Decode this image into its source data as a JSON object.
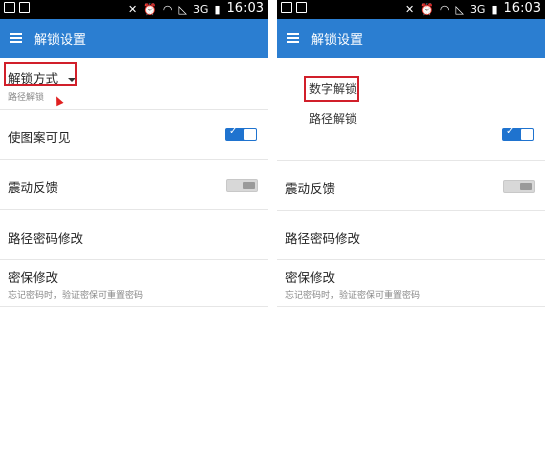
{
  "left": {
    "status": {
      "time": "16:03",
      "network": "3G"
    },
    "appbar": {
      "title": "解锁设置"
    },
    "unlock_method": {
      "label": "解锁方式",
      "value": "路径解锁"
    },
    "rows": [
      {
        "title": "使图案可见",
        "toggle": "on"
      },
      {
        "title": "震动反馈",
        "toggle": "off"
      },
      {
        "title": "路径密码修改"
      },
      {
        "title": "密保修改",
        "subtitle": "忘记密码时，验证密保可重置密码"
      }
    ]
  },
  "right": {
    "status": {
      "time": "16:03",
      "network": "3G"
    },
    "appbar": {
      "title": "解锁设置"
    },
    "menu": {
      "options": [
        "数字解锁",
        "路径解锁"
      ],
      "highlighted": "数字解锁"
    },
    "rows": [
      {
        "title": "震动反馈",
        "toggle": "off"
      },
      {
        "title": "路径密码修改"
      },
      {
        "title": "密保修改",
        "subtitle": "忘记密码时，验证密保可重置密码"
      }
    ],
    "pattern_visible_toggle": "on"
  },
  "colors": {
    "appbar": "#2b7ed1",
    "toggle_on": "#1f73cf",
    "highlight": "#d11f2a"
  }
}
